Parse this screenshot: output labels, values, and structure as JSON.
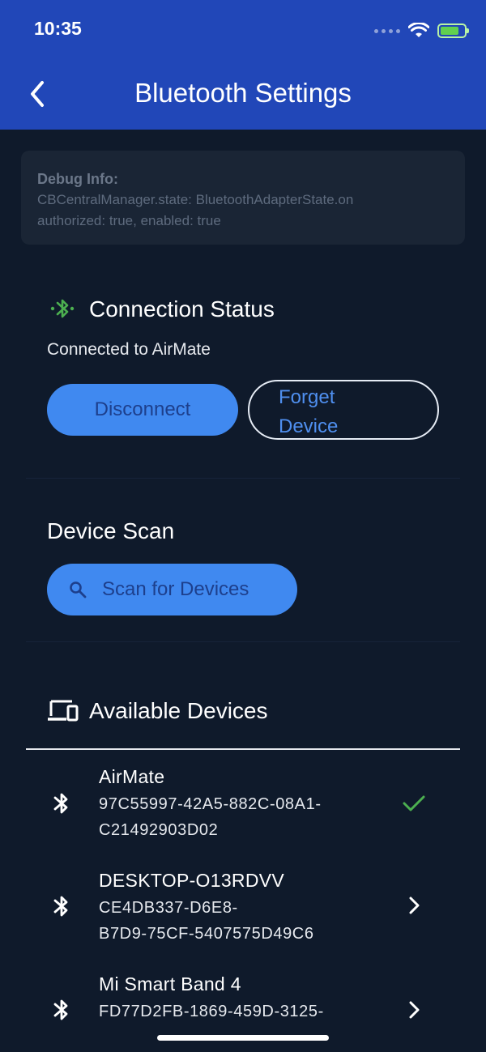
{
  "status_bar": {
    "time": "10:35"
  },
  "header": {
    "title": "Bluetooth Settings"
  },
  "debug": {
    "title": "Debug Info:",
    "line1": "CBCentralManager.state: BluetoothAdapterState.on",
    "line2": "authorized: true, enabled: true"
  },
  "connection": {
    "title": "Connection Status",
    "status_text": "Connected to AirMate",
    "disconnect_label": "Disconnect",
    "forget_line1": "Forget",
    "forget_line2": "Device"
  },
  "scan": {
    "title": "Device Scan",
    "button_label": "Scan for Devices"
  },
  "devices": {
    "title": "Available Devices",
    "items": [
      {
        "name": "AirMate",
        "uuid_line1": "97C55997-42A5-882C-08A1-",
        "uuid_line2": "C21492903D02",
        "status": "connected"
      },
      {
        "name": "DESKTOP-O13RDVV",
        "uuid_line1": "CE4DB337-D6E8-",
        "uuid_line2": "B7D9-75CF-5407575D49C6",
        "status": "available"
      },
      {
        "name": "Mi Smart Band 4",
        "uuid_line1": "FD77D2FB-1869-459D-3125-",
        "uuid_line2": "",
        "status": "available"
      }
    ]
  },
  "colors": {
    "header_bg": "#2147b8",
    "page_bg": "#0f1a2b",
    "primary_button": "#4089f0",
    "connected_green": "#4caf50"
  }
}
